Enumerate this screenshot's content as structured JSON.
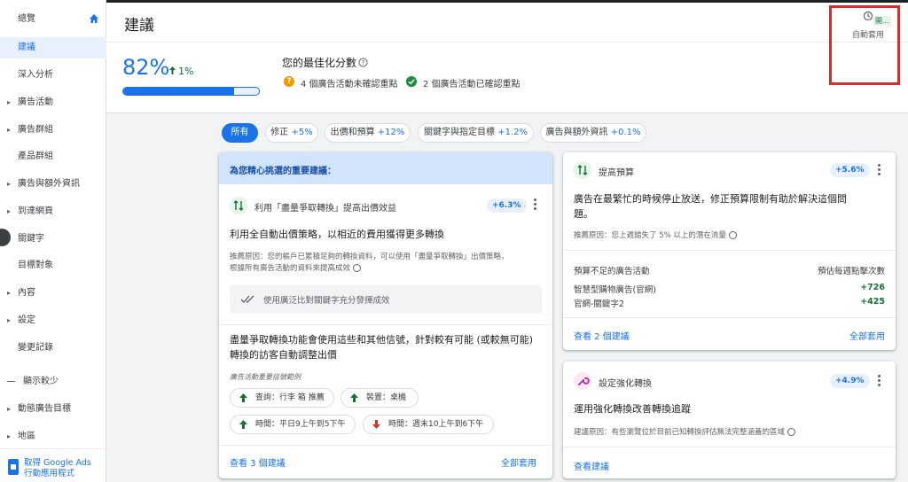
{
  "sidebar": {
    "items": [
      {
        "label": "總覽",
        "caret": false
      },
      {
        "label": "建議",
        "caret": false
      },
      {
        "label": "深入分析",
        "caret": false
      },
      {
        "label": "廣告活動",
        "caret": true
      },
      {
        "label": "廣告群組",
        "caret": true
      },
      {
        "label": "產品群組",
        "caret": false
      },
      {
        "label": "廣告與額外資訊",
        "caret": true
      },
      {
        "label": "到達網頁",
        "caret": true
      },
      {
        "label": "關鍵字",
        "caret": true
      },
      {
        "label": "目標對象",
        "caret": false
      },
      {
        "label": "內容",
        "caret": true
      },
      {
        "label": "設定",
        "caret": true
      },
      {
        "label": "變更記錄",
        "caret": false
      },
      {
        "label": "顯示較少",
        "caret": false
      },
      {
        "label": "動態廣告目標",
        "caret": true
      },
      {
        "label": "地區",
        "caret": true
      }
    ],
    "app_promo": {
      "line1": "取得 Google Ads",
      "line2": "行動應用程式"
    }
  },
  "header": {
    "title": "建議",
    "auto_apply_badge": "開...",
    "auto_apply_label": "自動套用"
  },
  "score": {
    "value": "82%",
    "delta": "1%",
    "progress": 0.82,
    "label": "您的最佳化分數",
    "status_warn": "4 個廣告活動未確認重點",
    "status_ok": "2 個廣告活動已確認重點"
  },
  "filters": {
    "chips": [
      {
        "label": "所有",
        "delta": ""
      },
      {
        "label": "修正",
        "delta": "+5%"
      },
      {
        "label": "出價和預算",
        "delta": "+12%"
      },
      {
        "label": "關鍵字與指定目標",
        "delta": "+1.2%"
      },
      {
        "label": "廣告與額外資訊",
        "delta": "+0.1%"
      }
    ]
  },
  "featured": {
    "banner": "為您精心挑選的重要建議：",
    "rec1": {
      "title": "利用「盡量爭取轉換」提高出價效益",
      "uplift": "+6.3%",
      "headline": "利用全自動出價策略，以相近的費用獲得更多轉換",
      "reason_line1": "推薦原因：您的帳戶已累積足夠的轉換資料，可以使用「盡量爭取轉換」出價策略，",
      "reason_line2": "根據所有廣告活動的資料來提高成效",
      "broad_match_text": "使用廣泛比對關鍵字充分發揮成效"
    },
    "rec2": {
      "headline_line1": "盡量爭取轉換功能會使用這些和其他信號，針對較有可能 (或較無可能)",
      "headline_line2": "轉換的訪客自動調整出價",
      "signals_label": "廣告活動重要信號範例",
      "signals": [
        {
          "label": "查詢：行李 箱 推薦",
          "direction": "up"
        },
        {
          "label": "裝置：桌機",
          "direction": "up"
        },
        {
          "label": "時間：平日9上午到5下午",
          "direction": "up"
        },
        {
          "label": "時間：週末10上午到6下午",
          "direction": "down"
        }
      ]
    },
    "view_link": "查看 3 個建議",
    "apply_all": "全部套用"
  },
  "budget_card": {
    "title": "提高預算",
    "uplift": "+5.6%",
    "headline_line1": "廣告在最繁忙的時候停止放送，修正預算限制有助於解決這個問",
    "headline_line2": "題。",
    "reason": "推薦原因：您上週錯失了 5% 以上的潛在流量",
    "col_campaign": "預算不足的廣告活動",
    "col_clicks": "預估每週點擊次數",
    "rows": [
      {
        "campaign": "智慧型購物廣告(官網)",
        "clicks": "+726"
      },
      {
        "campaign": "官網-關鍵字2",
        "clicks": "+425"
      }
    ],
    "view_link": "查看 2 個建議",
    "apply_all": "全部套用"
  },
  "conversion_card": {
    "title": "設定強化轉換",
    "uplift": "+4.9%",
    "headline": "運用強化轉換改善轉換追蹤",
    "reason": "建議原因：有些瀏覽位於目前已知轉換評估無法完整涵蓋的區域",
    "view_link": "查看建議"
  },
  "icons": [
    "home-icon",
    "history-icon",
    "help-icon",
    "warning-icon",
    "check-circle-icon",
    "swap-vert-icon",
    "more-vert-icon",
    "double-check-icon",
    "arrow-up-icon",
    "arrow-down-icon",
    "wrench-icon",
    "phone-icon"
  ],
  "colors": {
    "accent": "#1a73e8",
    "positive": "#137333",
    "warning": "#f29900",
    "negative": "#d93025",
    "highlight": "#d32f2f"
  }
}
